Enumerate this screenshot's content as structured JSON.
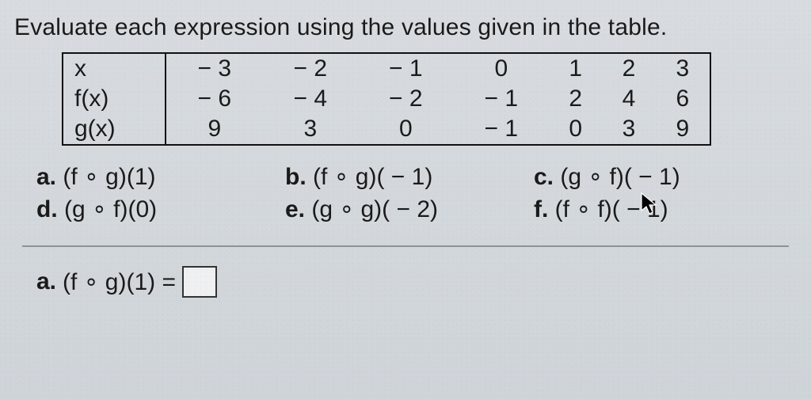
{
  "instruction": "Evaluate each expression using the values given in the table.",
  "table": {
    "rows": [
      {
        "label": "x",
        "cells": [
          "− 3",
          "− 2",
          "− 1",
          "0",
          "1",
          "2",
          "3"
        ]
      },
      {
        "label": "f(x)",
        "cells": [
          "− 6",
          "− 4",
          "− 2",
          "− 1",
          "2",
          "4",
          "6"
        ]
      },
      {
        "label": "g(x)",
        "cells": [
          "9",
          "3",
          "0",
          "− 1",
          "0",
          "3",
          "9"
        ]
      }
    ]
  },
  "questions": {
    "a": {
      "letter": "a.",
      "expr": "(f ∘ g)(1)"
    },
    "b": {
      "letter": "b.",
      "expr": "(f ∘ g)( − 1)"
    },
    "c": {
      "letter": "c.",
      "expr": "(g ∘ f)( − 1)"
    },
    "d": {
      "letter": "d.",
      "expr": "(g ∘ f)(0)"
    },
    "e": {
      "letter": "e.",
      "expr": "(g ∘ g)( − 2)"
    },
    "f": {
      "letter": "f.",
      "expr": "(f ∘ f)( − 1)"
    }
  },
  "answer_prompt": {
    "letter": "a.",
    "expr": "(f ∘ g)(1) ="
  },
  "chart_data": {
    "type": "table",
    "columns": [
      "x",
      "f(x)",
      "g(x)"
    ],
    "rows": [
      {
        "x": -3,
        "f(x)": -6,
        "g(x)": 9
      },
      {
        "x": -2,
        "f(x)": -4,
        "g(x)": 3
      },
      {
        "x": -1,
        "f(x)": -2,
        "g(x)": 0
      },
      {
        "x": 0,
        "f(x)": -1,
        "g(x)": -1
      },
      {
        "x": 1,
        "f(x)": 2,
        "g(x)": 0
      },
      {
        "x": 2,
        "f(x)": 4,
        "g(x)": 3
      },
      {
        "x": 3,
        "f(x)": 6,
        "g(x)": 9
      }
    ]
  }
}
